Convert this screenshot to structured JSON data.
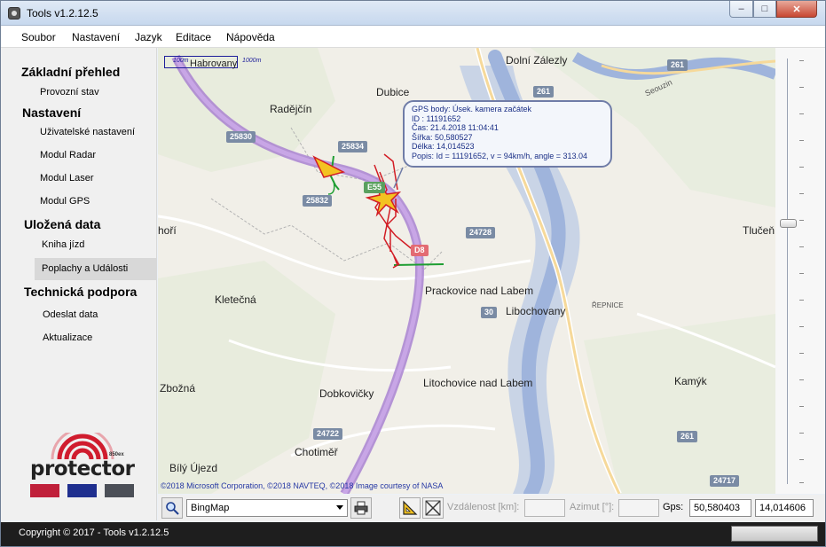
{
  "window": {
    "title": "Tools v1.2.12.5"
  },
  "menu": {
    "items": [
      "Soubor",
      "Nastavení",
      "Jazyk",
      "Editace",
      "Nápověda"
    ]
  },
  "sidebar": {
    "sections": [
      {
        "heading": "Základní přehled",
        "items": [
          "Provozní stav"
        ]
      },
      {
        "heading": "Nastavení",
        "items": [
          "Uživatelské nastavení",
          "Modul Radar",
          "Modul Laser",
          "Modul GPS"
        ]
      },
      {
        "heading": "Uložená data",
        "items": [
          "Kniha jízd",
          "Poplachy a Události"
        ]
      },
      {
        "heading": "Technická podpora",
        "items": [
          "Odeslat data",
          "Aktualizace"
        ]
      }
    ],
    "active_item": "Poplachy a Události"
  },
  "logo": {
    "text": "protector",
    "subtext": "850ex",
    "colors": [
      "#c0203a",
      "#1f2f8f",
      "#4b4f57"
    ]
  },
  "map": {
    "scale_left": "100m",
    "scale_right": "1000m",
    "scale_place": "Habrovany",
    "places": [
      "Dolní Zálezly",
      "Dubice",
      "Radějčín",
      "Tlučeň",
      "Prackovice nad Labem",
      "Libochovany",
      "ŘEPNICE",
      "Kletečná",
      "Zbožná",
      "Dobkovičky",
      "Litochovice nad Labem",
      "Kamýk",
      "Chotiměř",
      "Bílý Újezd",
      "Seouzin",
      "hoří"
    ],
    "shields": [
      "261",
      "261",
      "25830",
      "25834",
      "25832",
      "E55",
      "D8",
      "24728",
      "30",
      "24722",
      "261",
      "24717"
    ],
    "copyright": "©2018 Microsoft Corporation, ©2018 NAVTEQ, ©2018 Image courtesy of NASA",
    "gps_bubble": {
      "line1": "GPS body: Úsek. kamera začátek",
      "line2": "ID : 11191652",
      "line3": "Čas: 21.4.2018 11:04:41",
      "line4": "Šířka: 50,580527",
      "line5": "Délka: 14,014523",
      "line6": "Popis: Id = 11191652, v = 94km/h, angle = 313.04"
    }
  },
  "toolbar": {
    "map_source": "BingMap",
    "distance_label": "Vzdálenost [km]:",
    "distance_value": "",
    "azimuth_label": "Azimut [°]:",
    "azimuth_value": "",
    "gps_label": "Gps:",
    "gps_lat": "50,580403",
    "gps_lon": "14,014606"
  },
  "status": {
    "copyright": "Copyright © 2017 - Tools v1.2.12.5"
  },
  "colors": {
    "road_purple": "#b58ad6",
    "river": "#9fb4dc",
    "route_red": "#d21d25",
    "route_green": "#1e9e32"
  }
}
